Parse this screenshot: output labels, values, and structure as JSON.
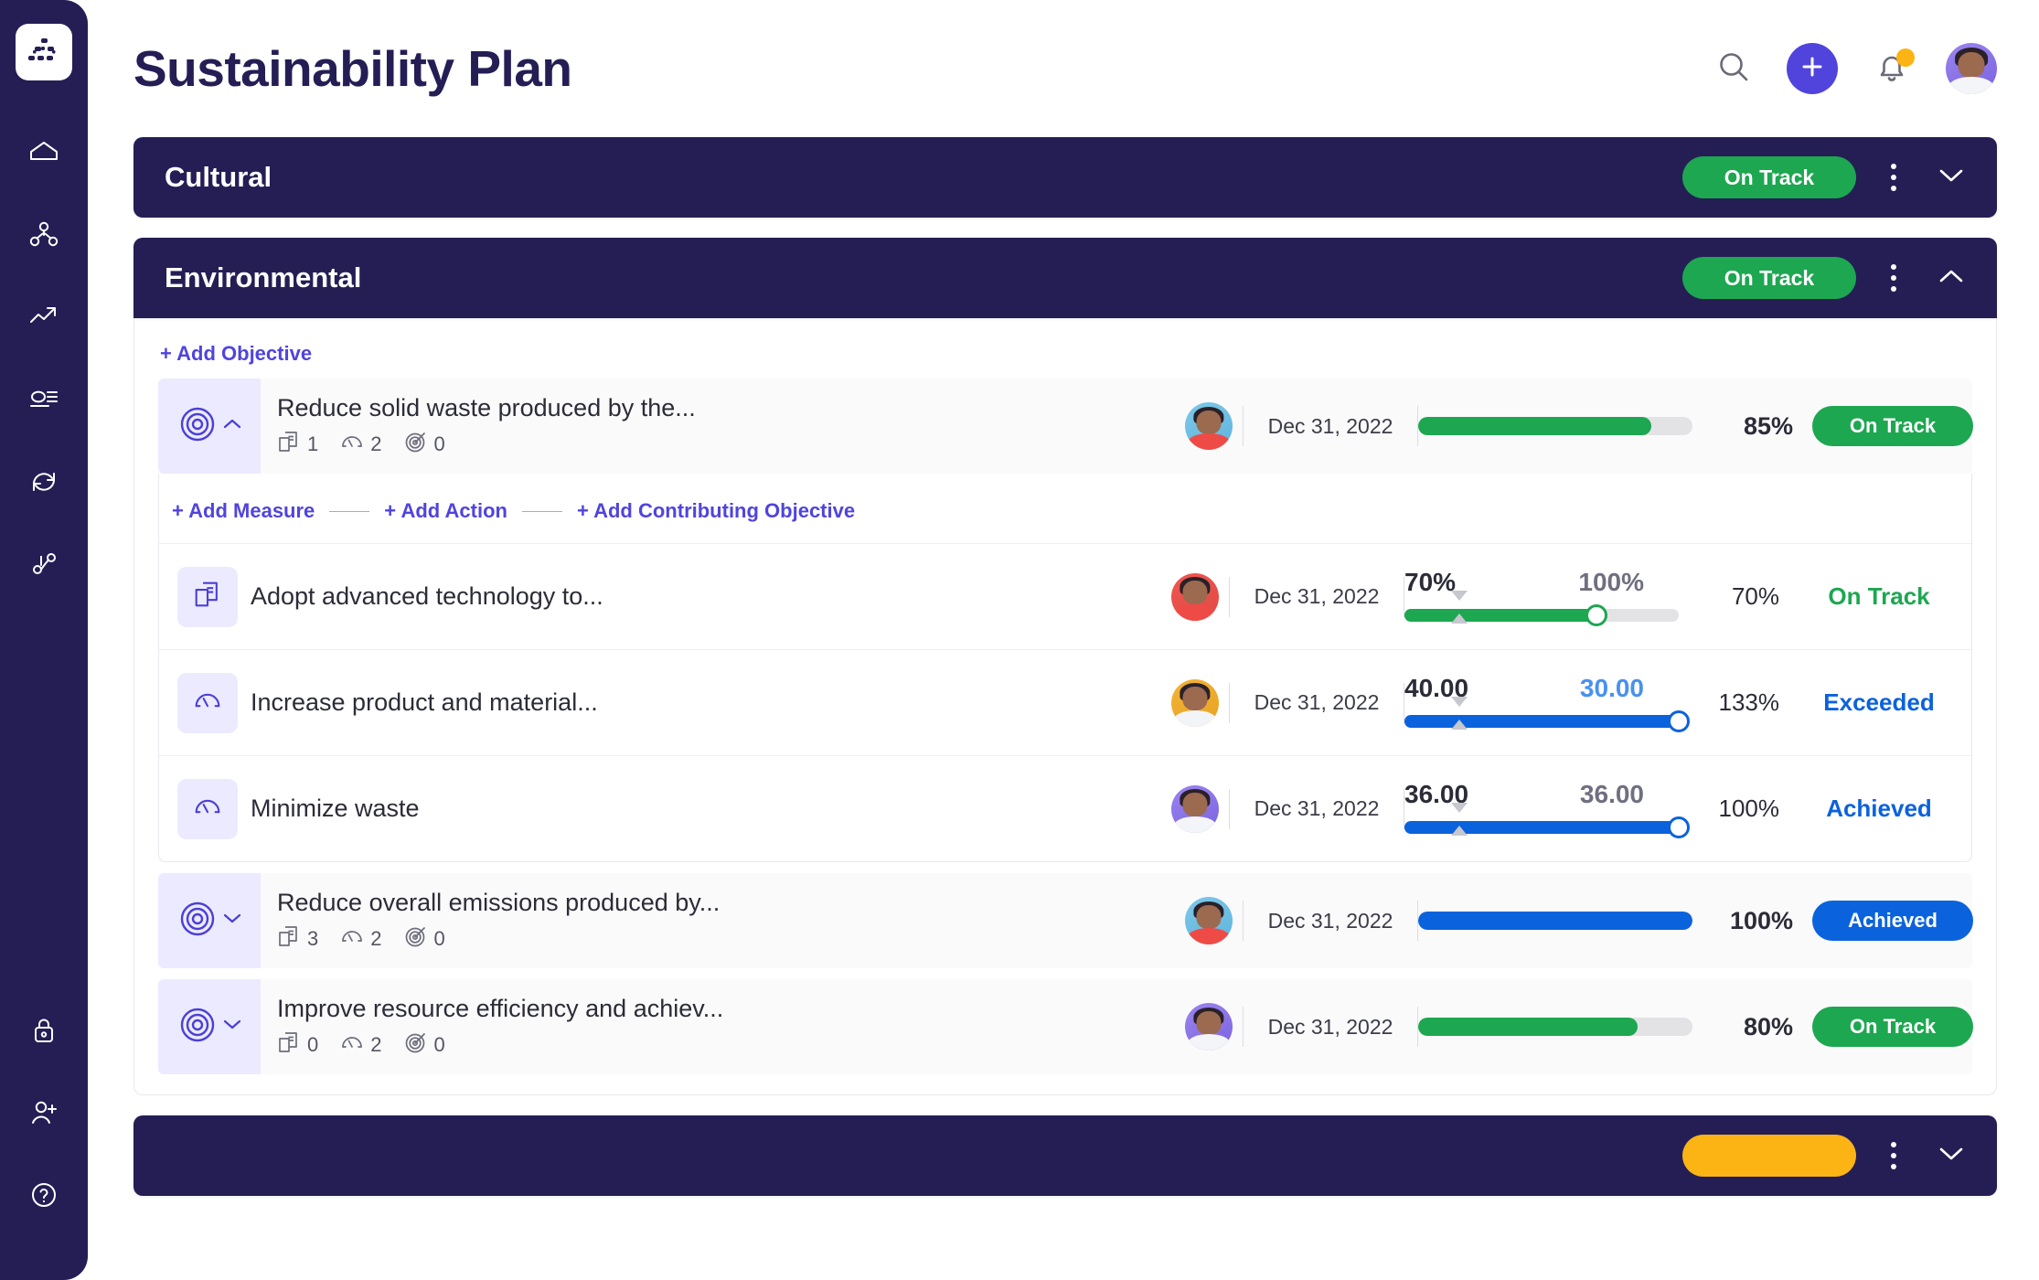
{
  "sidebar": {
    "logo": "dots-logo-icon",
    "top_items": [
      {
        "name": "home-icon"
      },
      {
        "name": "org-chart-icon"
      },
      {
        "name": "trending-up-icon"
      },
      {
        "name": "list-view-icon"
      },
      {
        "name": "refresh-sync-icon"
      },
      {
        "name": "workflow-branch-icon"
      }
    ],
    "bottom_items": [
      {
        "name": "lock-icon"
      },
      {
        "name": "add-user-icon"
      },
      {
        "name": "help-circle-icon"
      }
    ]
  },
  "header": {
    "title": "Sustainability Plan",
    "search_icon": "search-icon",
    "add_icon": "plus-icon",
    "notifications_icon": "bell-icon",
    "has_notification": true,
    "avatar": "user-avatar"
  },
  "accent": {
    "brand_purple": "#5044dd",
    "navy": "#241e55",
    "green": "#1da750",
    "blue": "#0b62dd",
    "amber": "#fcb415",
    "icon_tile": "#eceaff"
  },
  "sections": [
    {
      "title": "Cultural",
      "status": "On Track",
      "status_color": "green",
      "expanded": false,
      "chevron": "chevron-down-icon"
    },
    {
      "title": "Environmental",
      "status": "On Track",
      "status_color": "green",
      "expanded": true,
      "chevron": "chevron-up-icon",
      "add_objective": "+ Add Objective",
      "objectives": [
        {
          "name": "Reduce solid waste produced by the...",
          "expanded": true,
          "chevron": "chevron-up-icon",
          "actions_count": "1",
          "measures_count": "2",
          "contrib_count": "0",
          "owner_avatar": "avatar-red-shirt",
          "date": "Dec 31, 2022",
          "progress": 85,
          "progress_color": "green",
          "percent": "85%",
          "status": "On Track",
          "status_color": "green",
          "add_links": {
            "measure": "+ Add Measure",
            "action": "+ Add Action",
            "contributing": "+ Add Contributing Objective"
          },
          "measures": [
            {
              "icon": "action-document-icon",
              "name": "Adopt advanced technology to...",
              "owner_avatar": "avatar-red-circle",
              "date": "Dec 31, 2022",
              "current_value": "70%",
              "target_value": "100%",
              "target_color": "grey",
              "fill": 70,
              "knob": 70,
              "marker": 20,
              "bar_color": "green",
              "percent": "70%",
              "status": "On Track",
              "status_color": "green"
            },
            {
              "icon": "gauge-measure-icon",
              "name": "Increase product and material...",
              "owner_avatar": "avatar-orange",
              "date": "Dec 31, 2022",
              "current_value": "40.00",
              "target_value": "30.00",
              "target_color": "blue",
              "fill": 100,
              "knob": 100,
              "marker": 20,
              "bar_color": "blue",
              "percent": "133%",
              "status": "Exceeded",
              "status_color": "blue"
            },
            {
              "icon": "gauge-measure-icon",
              "name": "Minimize waste",
              "owner_avatar": "avatar-purple",
              "date": "Dec 31, 2022",
              "current_value": "36.00",
              "target_value": "36.00",
              "target_color": "grey",
              "fill": 100,
              "knob": 100,
              "marker": 20,
              "bar_color": "blue",
              "percent": "100%",
              "status": "Achieved",
              "status_color": "blue"
            }
          ]
        },
        {
          "name": "Reduce overall emissions produced by...",
          "expanded": false,
          "chevron": "chevron-down-icon",
          "actions_count": "3",
          "measures_count": "2",
          "contrib_count": "0",
          "owner_avatar": "avatar-red-shirt",
          "date": "Dec 31, 2022",
          "progress": 100,
          "progress_color": "blue",
          "percent": "100%",
          "status": "Achieved",
          "status_color": "blue"
        },
        {
          "name": "Improve resource efficiency and achiev...",
          "expanded": false,
          "chevron": "chevron-down-icon",
          "actions_count": "0",
          "measures_count": "2",
          "contrib_count": "0",
          "owner_avatar": "avatar-purple",
          "date": "Dec 31, 2022",
          "progress": 80,
          "progress_color": "green",
          "percent": "80%",
          "status": "On Track",
          "status_color": "green"
        }
      ]
    },
    {
      "title": "",
      "status": "",
      "status_color": "amber",
      "expanded": false,
      "chevron": "chevron-down-icon"
    }
  ]
}
